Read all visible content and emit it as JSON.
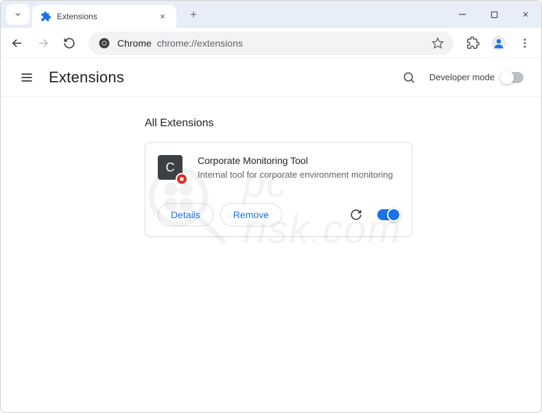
{
  "titlebar": {
    "tab_title": "Extensions"
  },
  "toolbar": {
    "omnibox_prefix": "Chrome",
    "omnibox_url": "chrome://extensions"
  },
  "page": {
    "title": "Extensions",
    "dev_mode_label": "Developer mode",
    "section_title": "All Extensions"
  },
  "extension": {
    "icon_letter": "C",
    "name": "Corporate Monitoring Tool",
    "description": "Internal tool for corporate environment monitoring",
    "details_label": "Details",
    "remove_label": "Remove",
    "enabled": true
  },
  "watermark": {
    "text_top": "pc",
    "text_bottom": "risk.com"
  }
}
